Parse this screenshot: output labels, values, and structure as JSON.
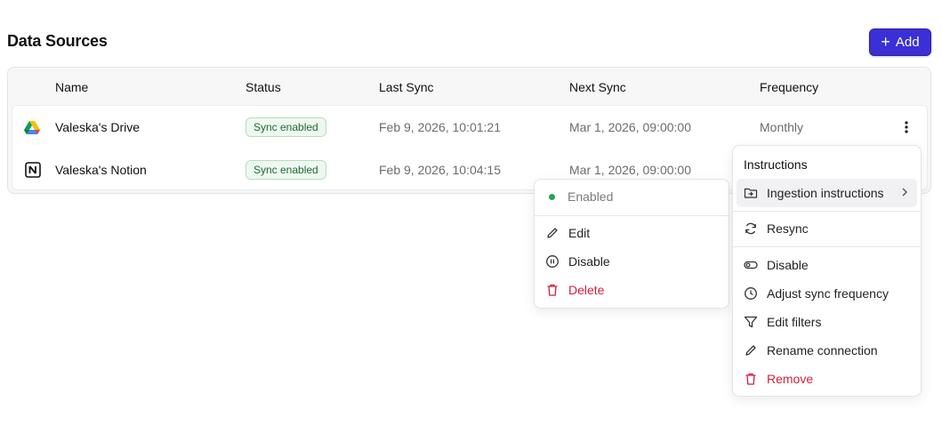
{
  "page": {
    "title": "Data Sources"
  },
  "toolbar": {
    "add_label": "Add"
  },
  "table": {
    "columns": [
      "Name",
      "Status",
      "Last Sync",
      "Next Sync",
      "Frequency"
    ],
    "rows": [
      {
        "icon": "google-drive-icon",
        "name": "Valeska's Drive",
        "status": "Sync enabled",
        "last_sync": "Feb 9, 2026, 10:01:21",
        "next_sync": "Mar 1, 2026, 09:00:00",
        "frequency": "Monthly"
      },
      {
        "icon": "notion-icon",
        "name": "Valeska's Notion",
        "status": "Sync enabled",
        "last_sync": "Feb 9, 2026, 10:04:15",
        "next_sync": "Mar 1, 2026, 09:00:00",
        "frequency": ""
      }
    ]
  },
  "status_menu": {
    "status": "Enabled",
    "items": [
      "Edit",
      "Disable",
      "Delete"
    ]
  },
  "actions_menu": {
    "heading": "Instructions",
    "items": [
      "Ingestion instructions",
      "Resync",
      "Disable",
      "Adjust sync frequency",
      "Edit filters",
      "Rename connection",
      "Remove"
    ]
  },
  "colors": {
    "accent": "#3b2fd6",
    "success": "#22a55a",
    "danger": "#d21f3c"
  }
}
